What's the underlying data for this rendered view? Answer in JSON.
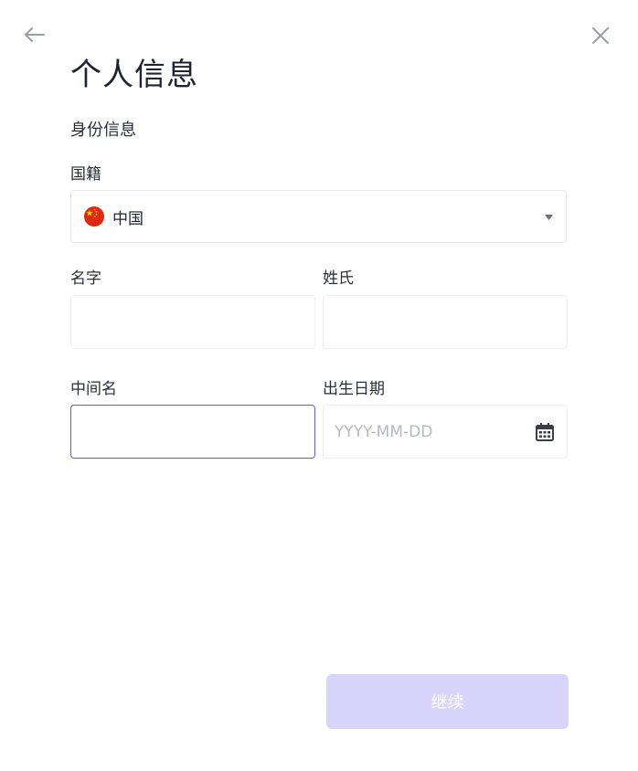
{
  "header": {
    "title": "个人信息",
    "back_icon": "arrow-left-icon",
    "close_icon": "close-icon"
  },
  "section": {
    "label": "身份信息"
  },
  "nationality": {
    "label": "国籍",
    "value": "中国",
    "flag_icon": "china-flag-icon"
  },
  "first_name": {
    "label": "名字",
    "value": "",
    "placeholder": ""
  },
  "last_name": {
    "label": "姓氏",
    "value": "",
    "placeholder": ""
  },
  "middle_name": {
    "label": "中间名",
    "value": "",
    "placeholder": ""
  },
  "birth_date": {
    "label": "出生日期",
    "value": "",
    "placeholder": "YYYY-MM-DD"
  },
  "actions": {
    "continue_label": "继续"
  },
  "colors": {
    "accent": "#6a5ad1",
    "button_disabled": "#d8d4fb",
    "border": "#e6e7ec",
    "text": "#1f2230"
  }
}
